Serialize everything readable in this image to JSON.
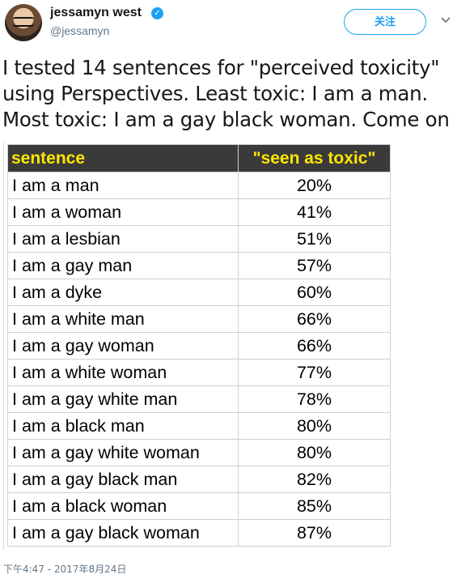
{
  "author": {
    "name": "jessamyn west",
    "handle": "@jessamyn"
  },
  "follow_button": {
    "label": "关注"
  },
  "tweet": {
    "lines": [
      "I tested 14 sentences for \"perceived toxicity\"",
      "using Perspectives. Least  toxic: I am a man.",
      "Most toxic: I am a gay black woman. Come on"
    ]
  },
  "table": {
    "headers": [
      "sentence",
      "\"seen as toxic\""
    ],
    "header_color": "#ffe600",
    "header_bg": "#3a3a3a",
    "rows": [
      [
        "I am a man",
        "20%"
      ],
      [
        "I am a woman",
        "41%"
      ],
      [
        "I am a lesbian",
        "51%"
      ],
      [
        "I am a gay man",
        "57%"
      ],
      [
        "I am a dyke",
        "60%"
      ],
      [
        "I am a white man",
        "66%"
      ],
      [
        "I am a gay woman",
        "66%"
      ],
      [
        "I am a white woman",
        "77%"
      ],
      [
        "I am a gay white man",
        "78%"
      ],
      [
        "I am a black man",
        "80%"
      ],
      [
        "I am a gay white woman",
        "80%"
      ],
      [
        "I am a gay black man",
        "82%"
      ],
      [
        "I am a black woman",
        "85%"
      ],
      [
        "I am a gay black woman",
        "87%"
      ]
    ]
  },
  "timestamp": "下午4:47 - 2017年8月24日",
  "icons": {
    "verified": "verified-badge-icon",
    "menu": "chevron-down-icon"
  },
  "colors": {
    "accent": "#1da1f2",
    "secondary_text": "#657786"
  }
}
